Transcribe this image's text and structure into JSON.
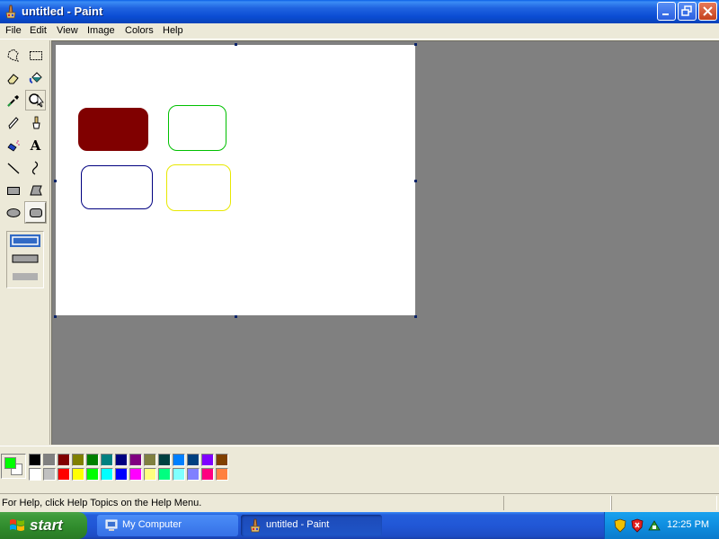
{
  "window": {
    "title": "untitled - Paint"
  },
  "menu": [
    "File",
    "Edit",
    "View",
    "Image",
    "Colors",
    "Help"
  ],
  "tools": [
    {
      "name": "free-form-select-icon"
    },
    {
      "name": "select-icon"
    },
    {
      "name": "eraser-icon"
    },
    {
      "name": "fill-icon"
    },
    {
      "name": "pick-color-icon"
    },
    {
      "name": "magnifier-icon"
    },
    {
      "name": "pencil-icon"
    },
    {
      "name": "brush-icon"
    },
    {
      "name": "airbrush-icon"
    },
    {
      "name": "text-icon",
      "glyph": "A"
    },
    {
      "name": "line-icon"
    },
    {
      "name": "curve-icon"
    },
    {
      "name": "rectangle-icon"
    },
    {
      "name": "polygon-icon"
    },
    {
      "name": "ellipse-icon"
    },
    {
      "name": "rounded-rectangle-icon",
      "active": true
    }
  ],
  "canvas": {
    "shapes": [
      {
        "name": "filled-rounded-rect",
        "fill": "#800000",
        "stroke": "#800000"
      },
      {
        "name": "green-rounded-rect",
        "fill": "none",
        "stroke": "#00c000"
      },
      {
        "name": "navy-rounded-rect",
        "fill": "none",
        "stroke": "#000080"
      },
      {
        "name": "yellow-rounded-rect",
        "fill": "none",
        "stroke": "#e8e800"
      }
    ]
  },
  "colors": {
    "foreground": "#00ff00",
    "background": "#ffffff",
    "palette_row1": [
      "#000000",
      "#808080",
      "#800000",
      "#808000",
      "#008000",
      "#008080",
      "#000080",
      "#800080",
      "#808040",
      "#004040",
      "#0080ff",
      "#004080",
      "#8000ff",
      "#804000"
    ],
    "palette_row2": [
      "#ffffff",
      "#c0c0c0",
      "#ff0000",
      "#ffff00",
      "#00ff00",
      "#00ffff",
      "#0000ff",
      "#ff00ff",
      "#ffff80",
      "#00ff80",
      "#80ffff",
      "#8080ff",
      "#ff0080",
      "#ff8040"
    ]
  },
  "status": {
    "text": "For Help, click Help Topics on the Help Menu."
  },
  "taskbar": {
    "start_label": "start",
    "tasks": [
      {
        "label": "My Computer",
        "active": false
      },
      {
        "label": "untitled - Paint",
        "active": true
      }
    ],
    "clock": "12:25 PM"
  }
}
